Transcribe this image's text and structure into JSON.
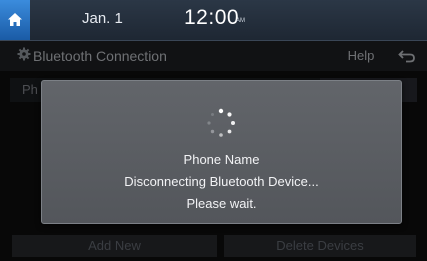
{
  "status_bar": {
    "date": "Jan.  1",
    "time": "12:00",
    "ampm": "AM",
    "home_icon": "home-icon"
  },
  "title_bar": {
    "title": "Bluetooth Connection",
    "help_label": "Help",
    "gear_icon": "gear-icon",
    "back_icon": "back-arrow-icon"
  },
  "list": {
    "row_label": "Ph"
  },
  "popup": {
    "icon": "spinner-icon",
    "device_name": "Phone Name",
    "message": "Disconnecting Bluetooth Device...",
    "wait_text": "Please wait."
  },
  "bottom": {
    "add_new_label": "Add New",
    "delete_devices_label": "Delete Devices"
  },
  "colors": {
    "home_button": "#2a76c9",
    "statusbar": "#26303c",
    "popup_bg": "#5b5e63"
  }
}
